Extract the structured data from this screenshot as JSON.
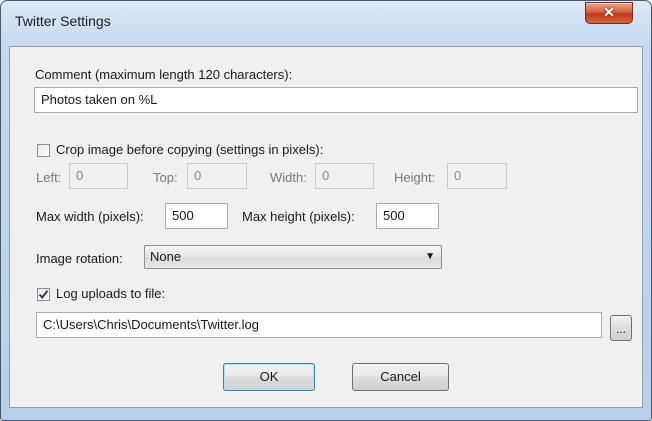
{
  "window": {
    "title": "Twitter Settings",
    "close_glyph": "✕"
  },
  "comment": {
    "label": "Comment (maximum length 120 characters):",
    "value": "Photos taken on %L"
  },
  "crop": {
    "checkbox_label": "Crop image before copying (settings in pixels):",
    "checked": false,
    "left_label": "Left:",
    "left_value": "0",
    "top_label": "Top:",
    "top_value": "0",
    "width_label": "Width:",
    "width_value": "0",
    "height_label": "Height:",
    "height_value": "0"
  },
  "size": {
    "max_width_label": "Max width (pixels):",
    "max_width_value": "500",
    "max_height_label": "Max height (pixels):",
    "max_height_value": "500"
  },
  "rotation": {
    "label": "Image rotation:",
    "value": "None",
    "arrow_icon": "triangle-down"
  },
  "log": {
    "checkbox_label": "Log uploads to file:",
    "checked": true,
    "path": "C:\\Users\\Chris\\Documents\\Twitter.log",
    "browse_label": "..."
  },
  "buttons": {
    "ok": "OK",
    "cancel": "Cancel"
  },
  "colors": {
    "frame": "#c4d7ee",
    "close": "#c0391a",
    "client": "#f0f0f0"
  }
}
